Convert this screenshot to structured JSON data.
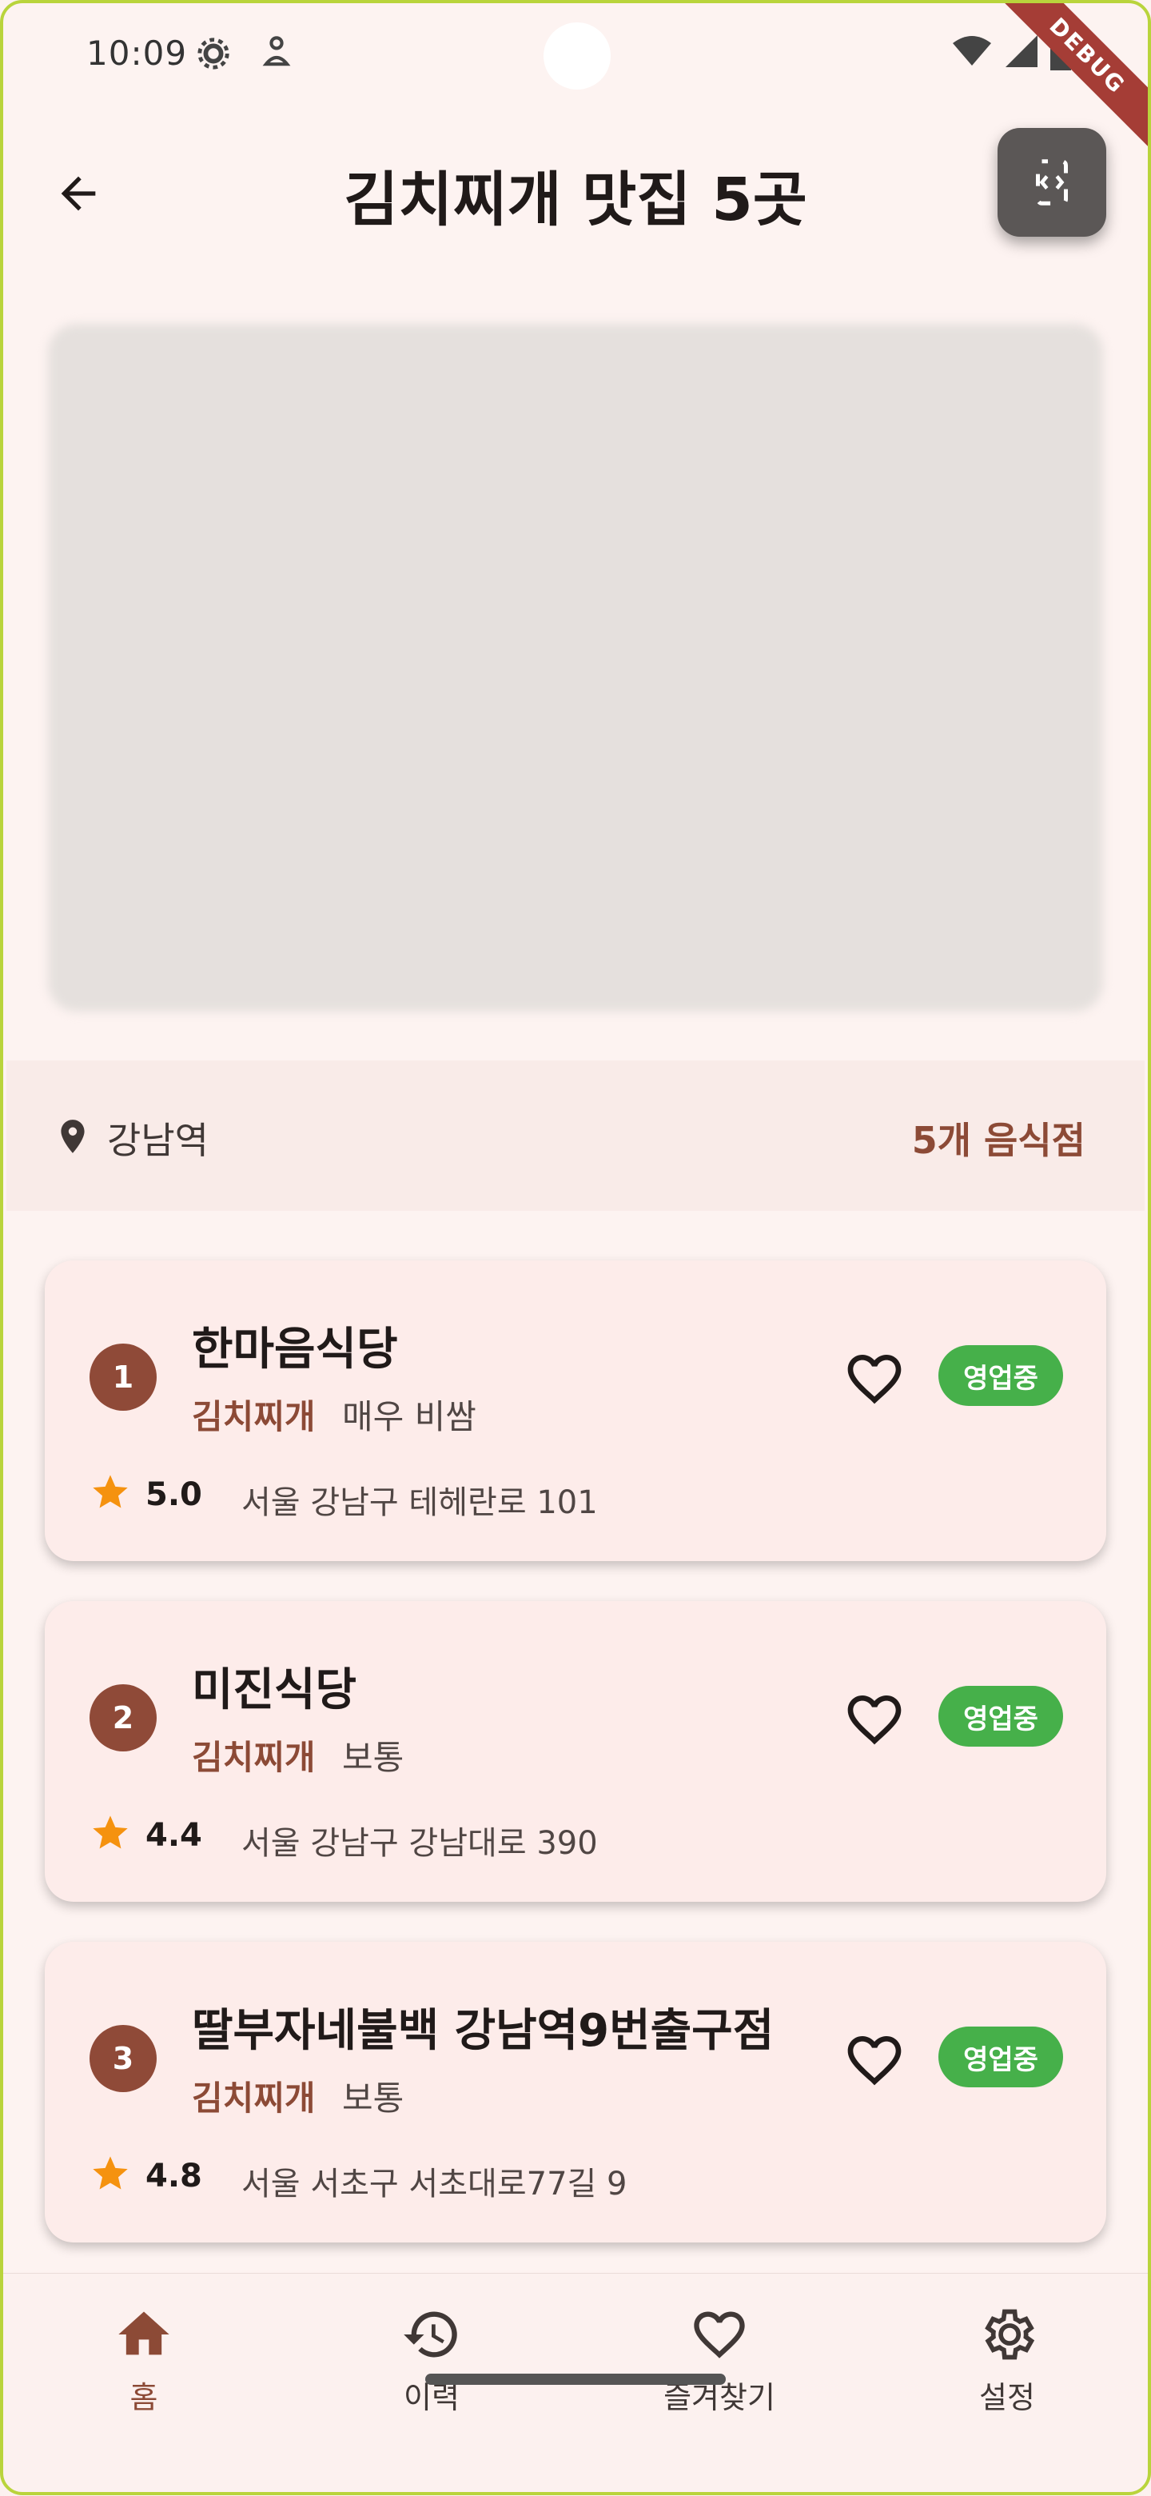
{
  "status_bar": {
    "time": "10:09"
  },
  "debug_banner": "DEBUG",
  "app_bar": {
    "title": "김치찌개 맛집 5곳"
  },
  "location": {
    "name": "강남역",
    "count_label": "5개 음식점"
  },
  "restaurants": [
    {
      "rank": "1",
      "name": "한마음식당",
      "category": "김치찌개",
      "spice": "매우 비쌈",
      "rating": "5.0",
      "address": "서울 강남구 테헤란로 101",
      "status": "영업중"
    },
    {
      "rank": "2",
      "name": "미진식당",
      "category": "김치찌개",
      "spice": "보통",
      "rating": "4.4",
      "address": "서울 강남구 강남대로 390",
      "status": "영업중"
    },
    {
      "rank": "3",
      "name": "딸부자네불백 강남역9번출구점",
      "category": "김치찌개",
      "spice": "보통",
      "rating": "4.8",
      "address": "서울 서초구 서초대로77길 9",
      "status": "영업중"
    }
  ],
  "bottom_nav": [
    {
      "label": "홈",
      "icon": "home-icon",
      "active": true
    },
    {
      "label": "이력",
      "icon": "history-icon",
      "active": false
    },
    {
      "label": "즐겨찾기",
      "icon": "heart-icon",
      "active": false
    },
    {
      "label": "설정",
      "icon": "gear-icon",
      "active": false
    }
  ],
  "colors": {
    "brand": "#8c4a36",
    "open_badge": "#46b04a",
    "star": "#f5920f",
    "background": "#fdf3f1"
  }
}
